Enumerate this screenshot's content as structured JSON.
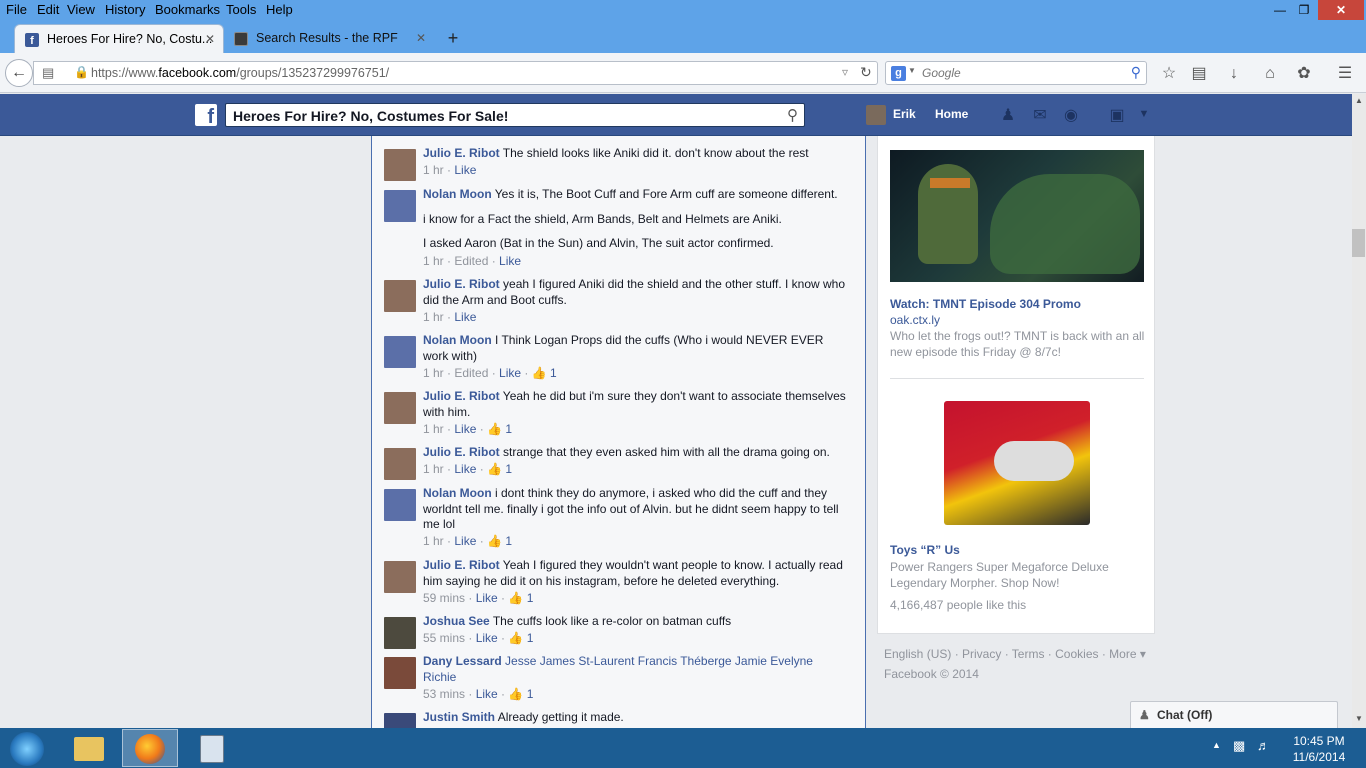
{
  "menu": [
    "File",
    "Edit",
    "View",
    "History",
    "Bookmarks",
    "Tools",
    "Help"
  ],
  "tabs": [
    {
      "title": "Heroes For Hire? No, Costu...",
      "active": true
    },
    {
      "title": "Search Results - the RPF",
      "active": false
    }
  ],
  "nav": {
    "url_prefix": "https://www.",
    "url_domain": "facebook.com",
    "url_path": "/groups/135237299976751/",
    "search_placeholder": "Google"
  },
  "fb": {
    "search_value": "Heroes For Hire? No, Costumes For Sale!",
    "user": "Erik",
    "home": "Home"
  },
  "comments": [
    {
      "name": "Julio E. Ribot",
      "text": "The shield looks like Aniki did it. don't know about the rest",
      "meta": "1 hr",
      "like": "Like",
      "likes": ""
    },
    {
      "name": "Nolan Moon",
      "text": "Yes it is, The Boot Cuff and Fore Arm cuff are someone different.",
      "text2": "i know for a Fact the shield, Arm Bands, Belt and Helmets are Aniki.",
      "text3": "I asked Aaron (Bat in the Sun) and Alvin, The suit actor confirmed.",
      "meta": "1 hr · Edited",
      "like": "Like",
      "likes": ""
    },
    {
      "name": "Julio E. Ribot",
      "text": "yeah I figured Aniki did the shield and the other stuff. I know who did the Arm and Boot cuffs.",
      "meta": "1 hr",
      "like": "Like",
      "likes": ""
    },
    {
      "name": "Nolan Moon",
      "text": "I Think Logan Props did the cuffs (Who i would NEVER EVER work with)",
      "meta": "1 hr · Edited",
      "like": "Like",
      "likes": "1"
    },
    {
      "name": "Julio E. Ribot",
      "text": "Yeah he did but i'm sure they don't want to associate themselves with him.",
      "meta": "1 hr",
      "like": "Like",
      "likes": "1"
    },
    {
      "name": "Julio E. Ribot",
      "text": "strange that they even asked him with all the drama going on.",
      "meta": "1 hr",
      "like": "Like",
      "likes": "1"
    },
    {
      "name": "Nolan Moon",
      "text": "i dont think they do anymore, i asked who did the cuff and they worldnt tell me. finally i got the info out of Alvin. but he didnt seem happy to tell me lol",
      "meta": "1 hr",
      "like": "Like",
      "likes": "1"
    },
    {
      "name": "Julio E. Ribot",
      "text": "Yeah I figured they wouldn't want people to know. I actually read him saying he did it on his instagram, before he deleted everything.",
      "meta": "59 mins",
      "like": "Like",
      "likes": "1"
    },
    {
      "name": "Joshua See",
      "text": "The cuffs look like a re-color on batman cuffs",
      "meta": "55 mins",
      "like": "Like",
      "likes": "1"
    },
    {
      "name": "Dany Lessard",
      "tags": "Jesse James St-Laurent Francis Théberge Jamie Evelyne Richie",
      "meta": "53 mins",
      "like": "Like",
      "likes": "1"
    },
    {
      "name": "Justin Smith",
      "text": "Already getting it made.",
      "meta": "",
      "like": "",
      "likes": ""
    }
  ],
  "ads": [
    {
      "title": "Watch: TMNT Episode 304 Promo",
      "link": "oak.ctx.ly",
      "text": "Who let the frogs out!? TMNT is back with an all new episode this Friday @ 8/7c!"
    },
    {
      "title": "Toys “R” Us",
      "text": "Power Rangers Super Megaforce Deluxe Legendary Morpher. Shop Now!",
      "social": "4,166,487 people like this"
    }
  ],
  "footer": {
    "line1": "English (US) · Privacy · Terms · Cookies · More ▾",
    "line2": "Facebook © 2014"
  },
  "chat": "Chat (Off)",
  "clock": {
    "time": "10:45 PM",
    "date": "11/6/2014"
  },
  "colors": {
    "fb_blue": "#3b5998",
    "titlebar": "#5ea3e8",
    "taskbar": "#1c5d93"
  }
}
